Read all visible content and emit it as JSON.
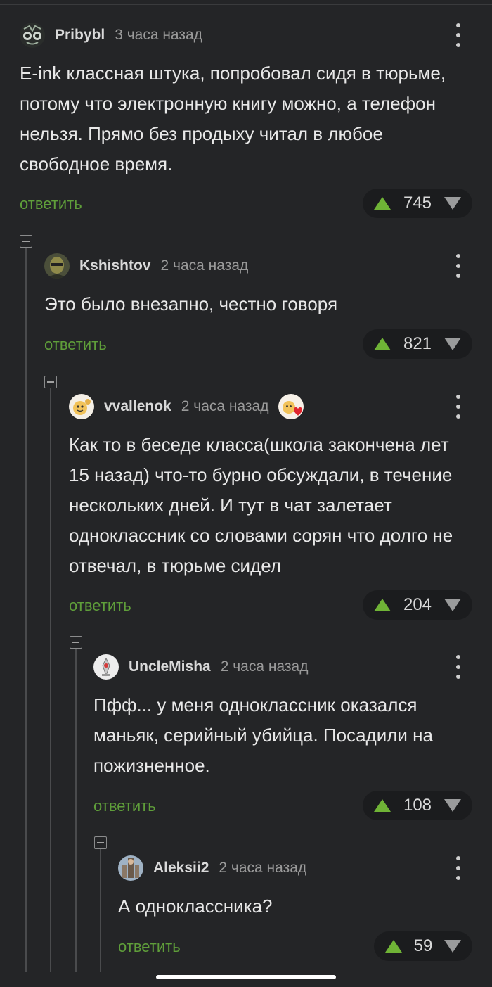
{
  "comments": [
    {
      "author": "Pribybl",
      "time": "3 часа назад",
      "text": "E-ink классная штука, попробовал сидя в тюрьме, потому что электронную книгу можно, а телефон нельзя. Прямо без продыху читал в любое свободное время.",
      "reply_label": "ответить",
      "score": "745"
    },
    {
      "author": "Kshishtov",
      "time": "2 часа назад",
      "text": "Это было внезапно, честно говоря",
      "reply_label": "ответить",
      "score": "821"
    },
    {
      "author": "vvallenok",
      "time": "2 часа назад",
      "text": "Как то в беседе класса(школа закончена лет 15 назад) что-то бурно обсуждали, в течение нескольких дней. И тут в чат залетает одноклассник со словами сорян что долго не отвечал, в тюрьме сидел",
      "reply_label": "ответить",
      "score": "204"
    },
    {
      "author": "UncleMisha",
      "time": "2 часа назад",
      "text": "Пфф... у меня одноклассник оказался маньяк, серийный убийца. Посадили на пожизненное.",
      "reply_label": "ответить",
      "score": "108"
    },
    {
      "author": "Aleksii2",
      "time": "2 часа назад",
      "text": "А одноклассника?",
      "reply_label": "ответить",
      "score": "59"
    }
  ],
  "icons": {
    "menu": "more-vertical-icon",
    "upvote": "arrow-up-icon",
    "downvote": "arrow-down-icon",
    "collapse": "collapse-minus-icon"
  },
  "colors": {
    "background": "#242527",
    "reply_link": "#5f9e3a",
    "upvote": "#6fb336",
    "downvote": "#9a9b9c",
    "vote_pill": "#1b1c1e"
  }
}
